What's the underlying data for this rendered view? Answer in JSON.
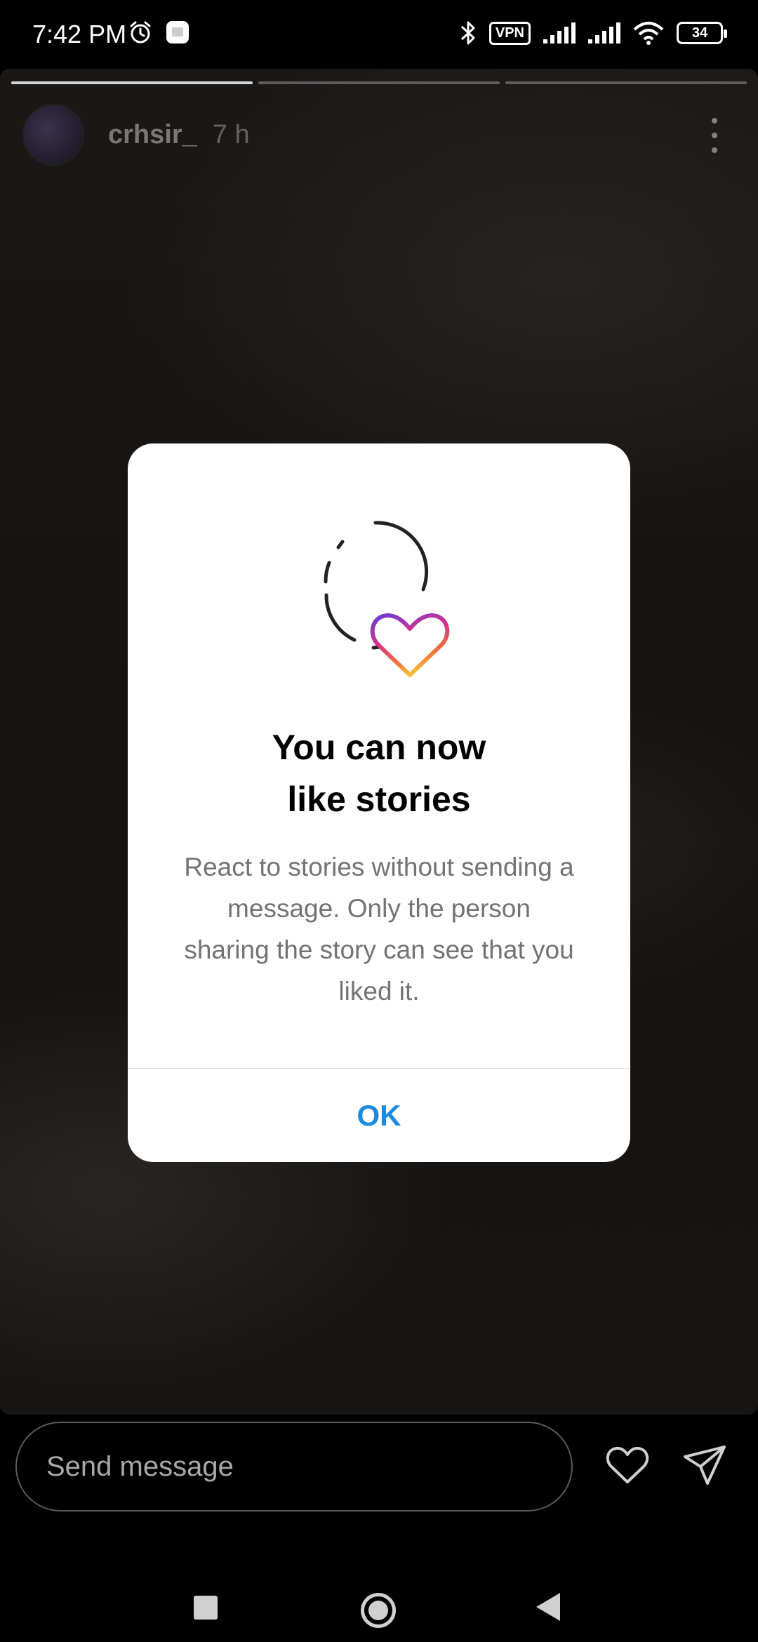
{
  "status_bar": {
    "time": "7:42 PM",
    "vpn_label": "VPN",
    "battery_level": "34",
    "icons": [
      "alarm-icon",
      "notification-app-icon",
      "bluetooth-icon",
      "vpn-icon",
      "signal-icon",
      "signal-icon",
      "wifi-icon",
      "battery-icon"
    ]
  },
  "story": {
    "username": "crhsir_",
    "time_ago": "7 h",
    "progress_segments": [
      1,
      0,
      0
    ],
    "icons": [
      "avatar",
      "more-vertical-icon"
    ]
  },
  "dialog": {
    "title": "You can now\nlike stories",
    "body": "React to stories without sending a message. Only the person sharing the story can see that you liked it.",
    "ok_label": "OK",
    "accent_color": "#1c8adf",
    "icon": "story-like-heart-icon"
  },
  "message_bar": {
    "placeholder": "Send message",
    "icons": [
      "heart-icon",
      "send-icon"
    ]
  },
  "nav_bar": {
    "icons": [
      "recents-icon",
      "home-icon",
      "back-icon"
    ]
  }
}
